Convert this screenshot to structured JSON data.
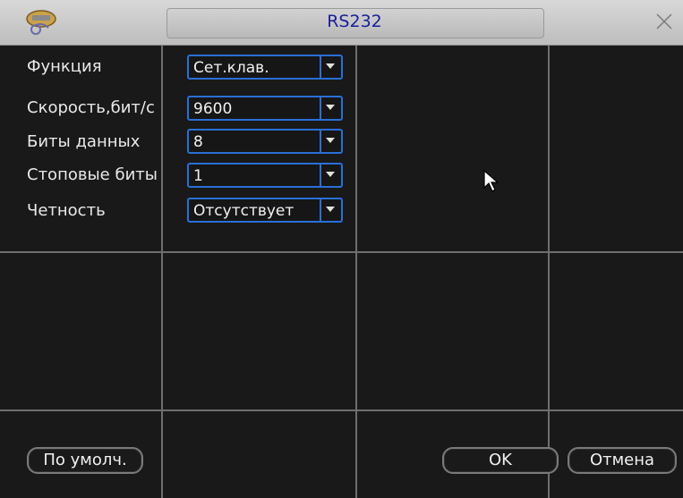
{
  "window": {
    "title": "RS232"
  },
  "fields": [
    {
      "label": "Функция",
      "value": "Сет.клав."
    },
    {
      "label": "Скорость,бит/с",
      "value": "9600"
    },
    {
      "label": "Биты данных",
      "value": "8"
    },
    {
      "label": "Стоповые биты",
      "value": "1"
    },
    {
      "label": "Четность",
      "value": "Отсутствует"
    }
  ],
  "buttons": {
    "default": "По умолч.",
    "ok": "OK",
    "cancel": "Отмена"
  },
  "icons": {
    "logo": "dvr-logo-icon",
    "close": "close-icon",
    "cursor": "mouse-cursor-icon",
    "dropdown": "chevron-down-icon"
  },
  "colors": {
    "accent": "#2a6fd6",
    "title": "#1a1f9a",
    "background": "#191919"
  }
}
